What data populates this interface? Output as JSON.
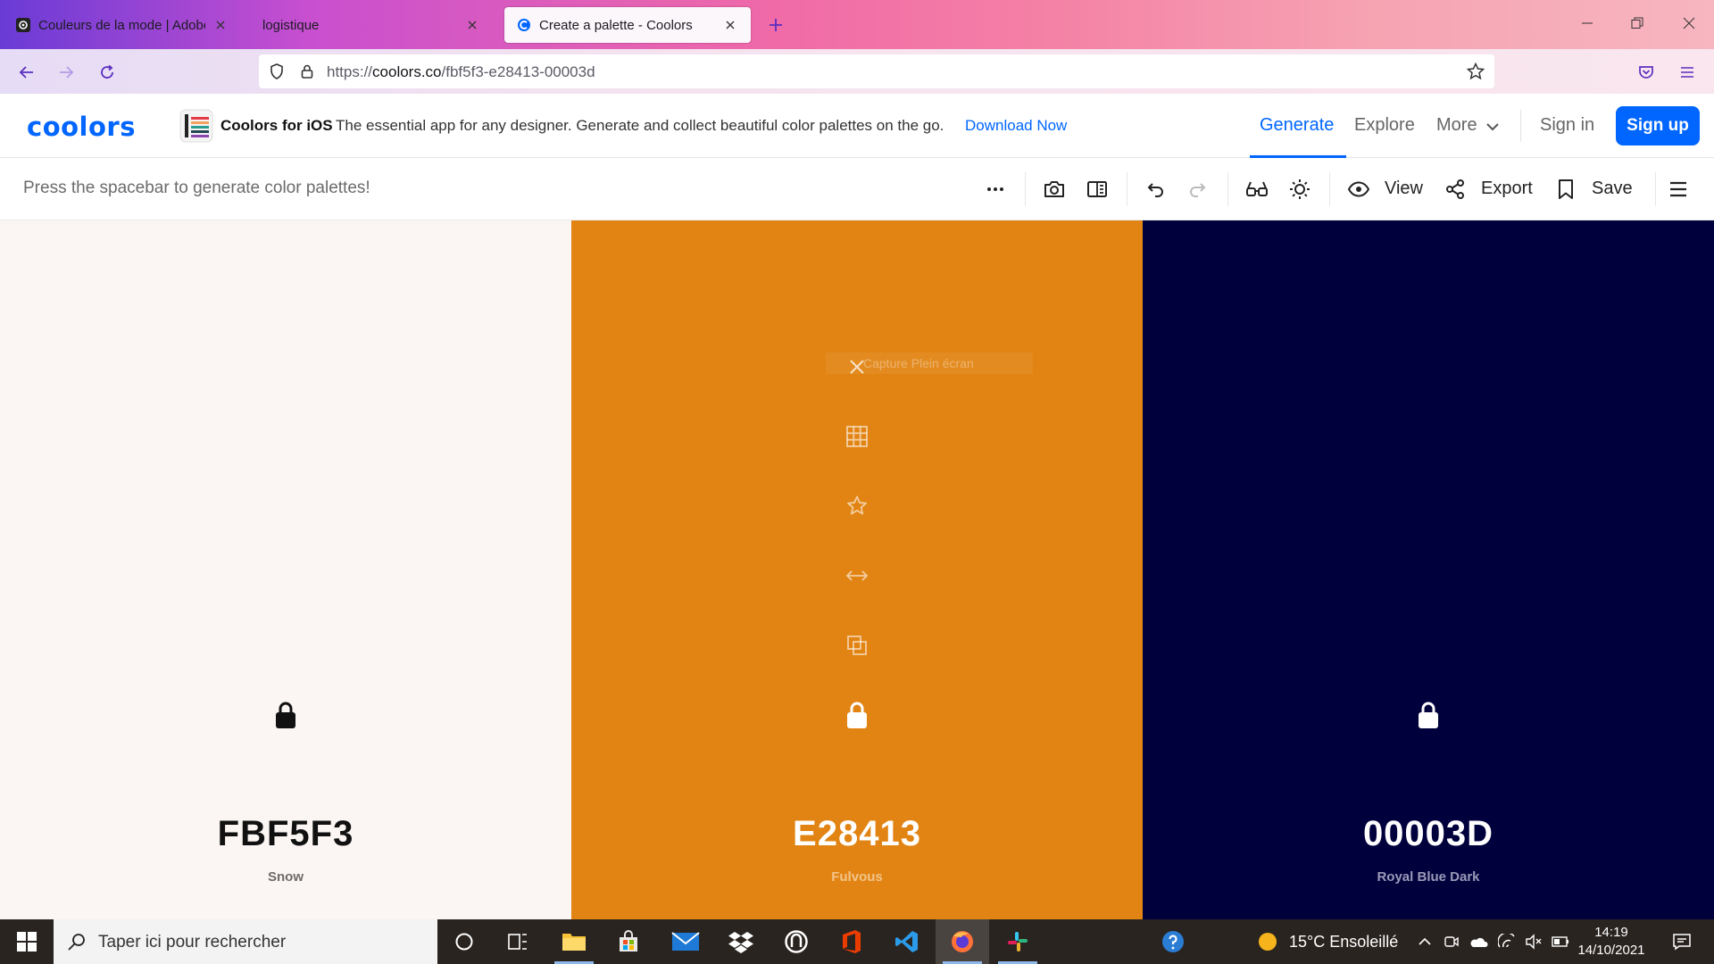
{
  "browser": {
    "tabs": [
      {
        "title": "Couleurs de la mode | Adobe C",
        "favicon": "adobe-color-icon",
        "active": false
      },
      {
        "title": "logistique",
        "favicon": "none",
        "active": false
      },
      {
        "title": "Create a palette - Coolors",
        "favicon": "coolors-icon",
        "active": true
      }
    ],
    "url_prefix": "https://",
    "url_domain": "coolors.co",
    "url_path": "/fbf5f3-e28413-00003d"
  },
  "site": {
    "logo": "coolors",
    "promo": {
      "title": "Coolors for iOS",
      "description": "The essential app for any designer. Generate and collect beautiful color palettes on the go.",
      "link": "Download Now"
    },
    "nav": {
      "generate": "Generate",
      "explore": "Explore",
      "more": "More",
      "signin": "Sign in",
      "signup": "Sign up"
    },
    "accent": "#0066ff"
  },
  "toolbar": {
    "hint": "Press the spacebar to generate color palettes!",
    "view": "View",
    "export": "Export",
    "save": "Save"
  },
  "palette": [
    {
      "hex": "FBF5F3",
      "name": "Snow",
      "color": "#fbf5f3",
      "text": "#111111",
      "sub": "#6e6a69",
      "locked": true
    },
    {
      "hex": "E28413",
      "name": "Fulvous",
      "color": "#e28413",
      "text": "#ffffff",
      "sub": "#f3c48a",
      "locked": true
    },
    {
      "hex": "00003D",
      "name": "Royal Blue Dark",
      "color": "#00003d",
      "text": "#ffffff",
      "sub": "#9a9ab8",
      "locked": true
    }
  ],
  "overlay": {
    "capture_text": "Capture Plein écran"
  },
  "taskbar": {
    "search_placeholder": "Taper ici pour rechercher",
    "weather": "15°C  Ensoleillé",
    "time": "14:19",
    "date": "14/10/2021"
  }
}
